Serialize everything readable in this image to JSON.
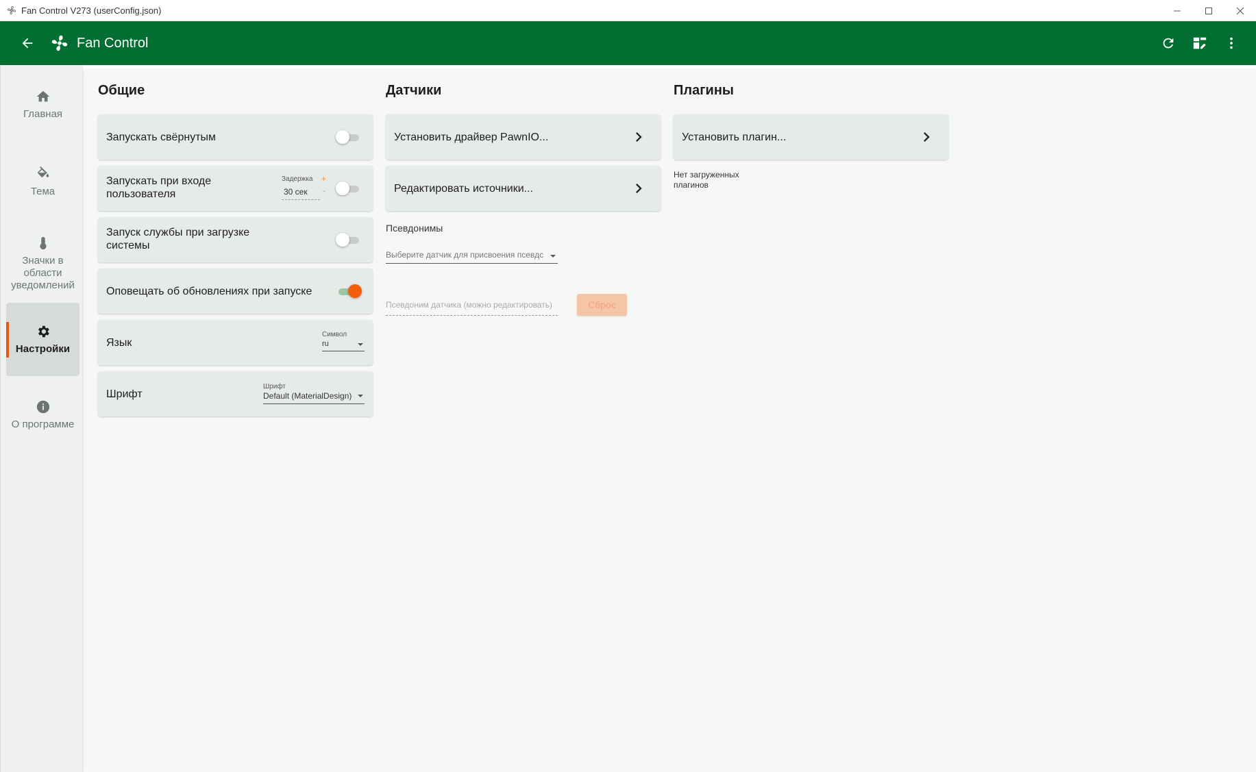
{
  "window": {
    "title": "Fan Control V273 (userConfig.json)"
  },
  "appbar": {
    "title": "Fan Control",
    "color": "#026e32"
  },
  "sidebar": {
    "items": [
      {
        "label": "Главная",
        "icon": "home-icon"
      },
      {
        "label": "Тема",
        "icon": "paint-bucket-icon"
      },
      {
        "label": "Значки в области уведомлений",
        "icon": "thermometer-icon"
      },
      {
        "label": "Настройки",
        "icon": "gear-icon",
        "active": true
      },
      {
        "label": "О программе",
        "icon": "info-icon"
      }
    ]
  },
  "general": {
    "title": "Общие",
    "start_minimized": {
      "label": "Запускать свёрнутым",
      "enabled": false
    },
    "start_on_login": {
      "label_line1": "Запускать при входе",
      "label_line2": "пользователя",
      "delay_label": "Задержка",
      "delay_value": "30 сек",
      "plus": "+",
      "minus": "-",
      "enabled": false
    },
    "service_boot": {
      "label_line1": "Запуск службы при загрузке",
      "label_line2": "системы",
      "enabled": false
    },
    "update_notify": {
      "label": "Оповещать об обновлениях при запуске",
      "enabled": true
    },
    "language": {
      "label": "Язык",
      "field_label": "Символ",
      "value": "ru"
    },
    "font": {
      "label": "Шрифт",
      "field_label": "Шрифт",
      "value": "Default (MaterialDesign)"
    }
  },
  "sensors": {
    "title": "Датчики",
    "install_driver": "Установить драйвер PawnIO...",
    "edit_sources": "Редактировать источники...",
    "aliases_title": "Псевдонимы",
    "select_placeholder": "Выберите датчик для присвоения псевдс",
    "alias_placeholder": "Псевдоним датчика (можно редактировать)",
    "reset_label": "Сброс"
  },
  "plugins": {
    "title": "Плагины",
    "install_plugin": "Установить плагин...",
    "none_line1": "Нет загруженных",
    "none_line2": "плагинов"
  },
  "colors": {
    "accent": "#e8560f",
    "toggle_on_thumb": "#f15e0e",
    "reset_button": "#f6c5a8"
  }
}
